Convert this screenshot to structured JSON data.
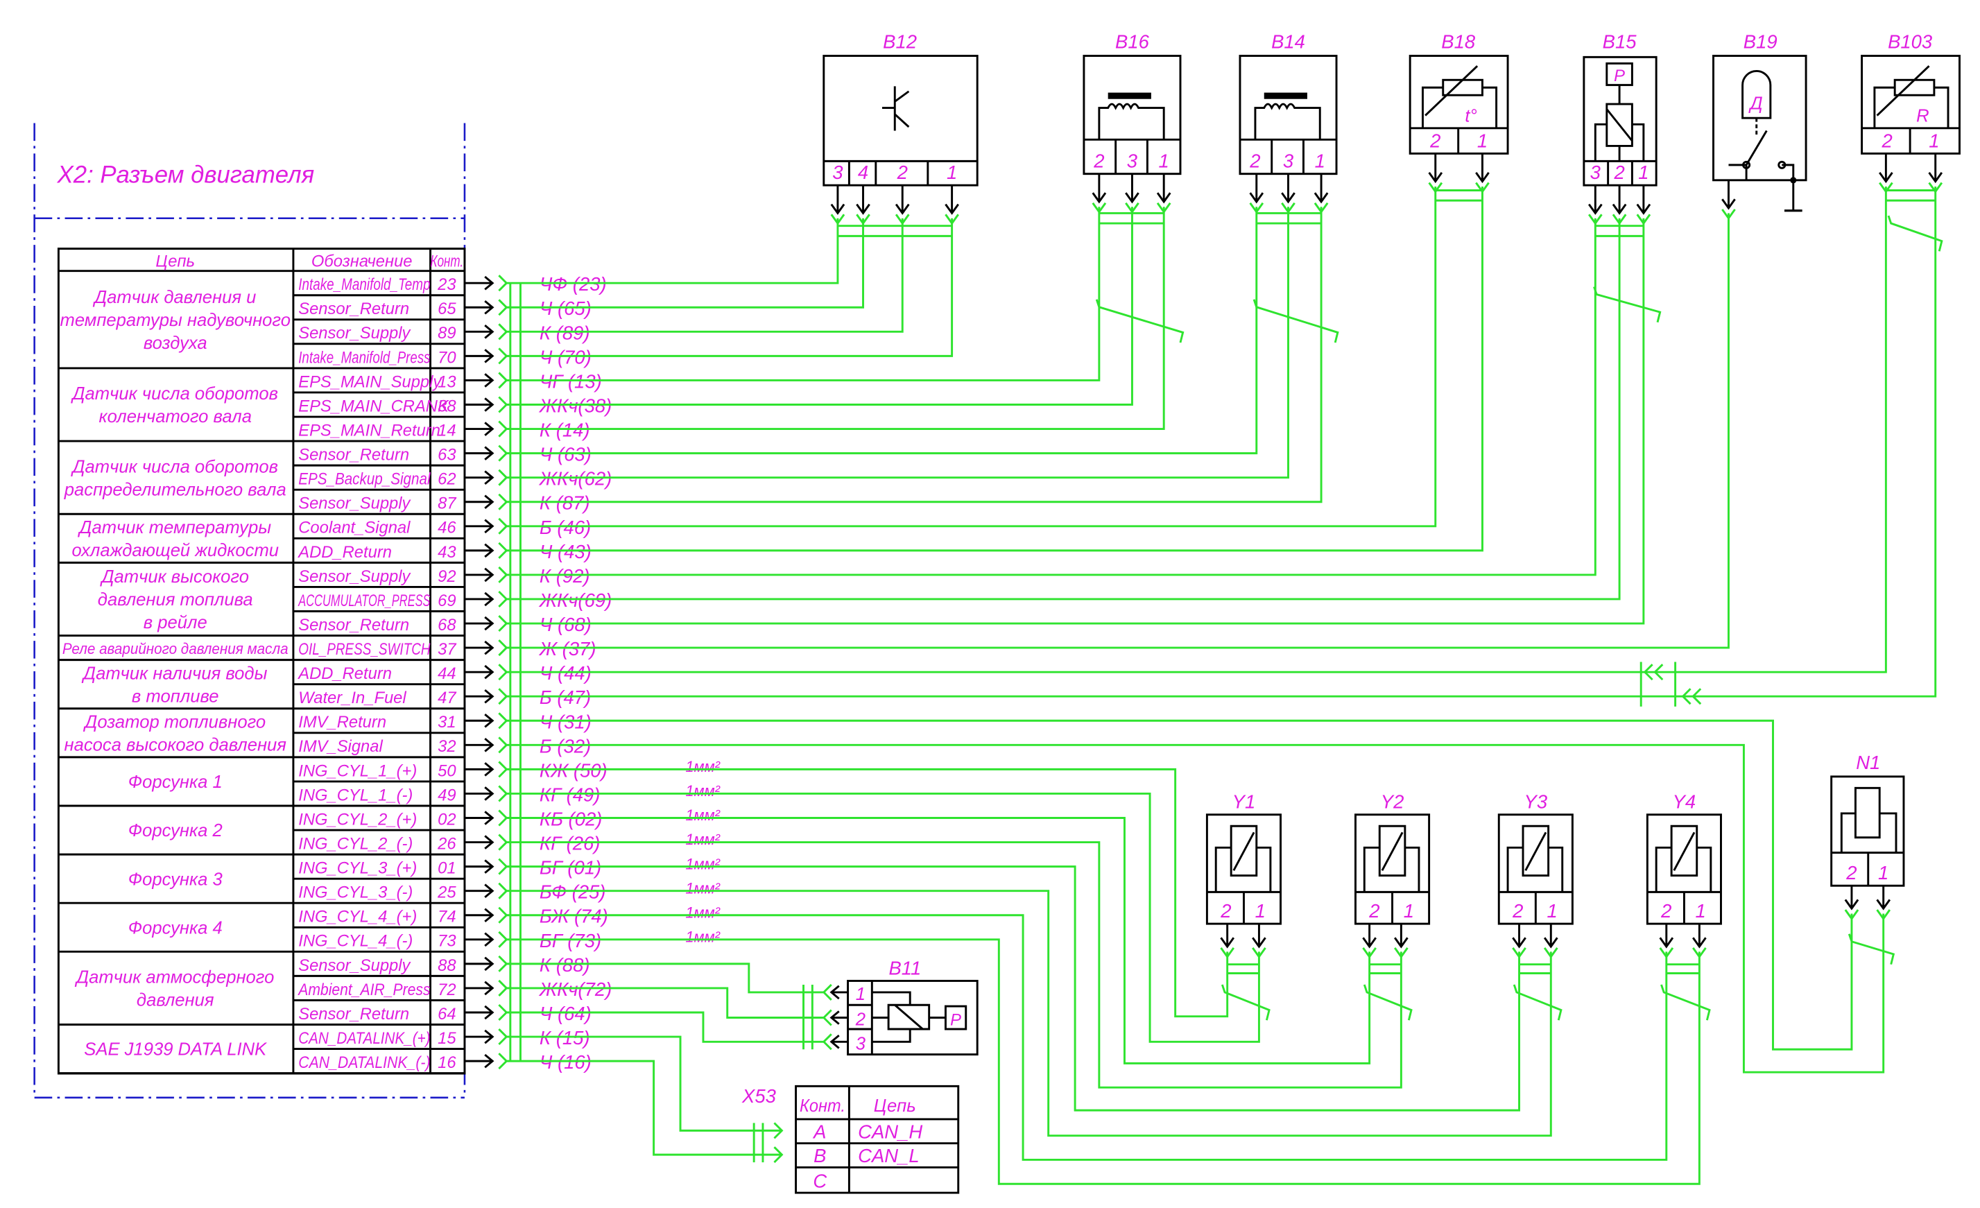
{
  "frame_title": "X2:   Разъем двигателя",
  "table": {
    "headers": [
      "Цепь",
      "Обозначение",
      "Конт."
    ],
    "groups": [
      {
        "lines": [
          "Датчик давления и",
          "температуры надувочного",
          "воздуха"
        ],
        "rows": 4
      },
      {
        "lines": [
          "Датчик числа оборотов",
          "коленчатого вала"
        ],
        "rows": 3
      },
      {
        "lines": [
          "Датчик числа оборотов",
          "распределительного вала"
        ],
        "rows": 3
      },
      {
        "lines": [
          "Датчик температуры",
          "охлаждающей жидкости"
        ],
        "rows": 2
      },
      {
        "lines": [
          "Датчик высокого",
          "давления топлива",
          "в рейле"
        ],
        "rows": 3
      },
      {
        "lines": [
          "Реле аварийного давления масла"
        ],
        "rows": 1
      },
      {
        "lines": [
          "Датчик наличия воды",
          "в топливе"
        ],
        "rows": 2
      },
      {
        "lines": [
          "Дозатор топливного",
          "насоса высокого давления"
        ],
        "rows": 2
      },
      {
        "lines": [
          "Форсунка 1"
        ],
        "rows": 2
      },
      {
        "lines": [
          "Форсунка 2"
        ],
        "rows": 2
      },
      {
        "lines": [
          "Форсунка 3"
        ],
        "rows": 2
      },
      {
        "lines": [
          "Форсунка 4"
        ],
        "rows": 2
      },
      {
        "lines": [
          "Датчик атмосферного",
          "давления"
        ],
        "rows": 3
      },
      {
        "lines": [
          "SAE J1939 DATA LINK"
        ],
        "rows": 2
      }
    ],
    "rows": [
      {
        "designation": "Intake_Manifold_Temp",
        "pin": "23",
        "wire": "ЧФ (23)"
      },
      {
        "designation": "Sensor_Return",
        "pin": "65",
        "wire": "Ч  (65)"
      },
      {
        "designation": "Sensor_Supply",
        "pin": "89",
        "wire": "К  (89)"
      },
      {
        "designation": "Intake_Manifold_Press",
        "pin": "70",
        "wire": "Ч  (70)"
      },
      {
        "designation": "EPS_MAIN_Supply",
        "pin": "13",
        "wire": "ЧГ (13)"
      },
      {
        "designation": "EPS_MAIN_CRANK",
        "pin": "38",
        "wire": "ЖКч(38)"
      },
      {
        "designation": "EPS_MAIN_Return",
        "pin": "14",
        "wire": "К  (14)"
      },
      {
        "designation": "Sensor_Return",
        "pin": "63",
        "wire": "Ч  (63)"
      },
      {
        "designation": "EPS_Backup_Signal",
        "pin": "62",
        "wire": "ЖКч(62)"
      },
      {
        "designation": "Sensor_Supply",
        "pin": "87",
        "wire": "К  (87)"
      },
      {
        "designation": "Coolant_Signal",
        "pin": "46",
        "wire": "Б  (46)"
      },
      {
        "designation": "ADD_Return",
        "pin": "43",
        "wire": "Ч  (43)"
      },
      {
        "designation": "Sensor_Supply",
        "pin": "92",
        "wire": "К  (92)"
      },
      {
        "designation": "ACCUMULATOR_PRESS",
        "pin": "69",
        "wire": "ЖКч(69)"
      },
      {
        "designation": "Sensor_Return",
        "pin": "68",
        "wire": "Ч  (68)"
      },
      {
        "designation": "OIL_PRESS_SWITCH",
        "pin": "37",
        "wire": "Ж  (37)"
      },
      {
        "designation": "ADD_Return",
        "pin": "44",
        "wire": "Ч  (44)"
      },
      {
        "designation": "Water_In_Fuel",
        "pin": "47",
        "wire": "Б  (47)"
      },
      {
        "designation": "IMV_Return",
        "pin": "31",
        "wire": "Ч  (31)"
      },
      {
        "designation": "IMV_Signal",
        "pin": "32",
        "wire": "Б  (32)"
      },
      {
        "designation": "ING_CYL_1_(+)",
        "pin": "50",
        "wire": "КЖ (50)",
        "section": "1мм²"
      },
      {
        "designation": "ING_CYL_1_(-)",
        "pin": "49",
        "wire": "КГ (49)",
        "section": "1мм²"
      },
      {
        "designation": "ING_CYL_2_(+)",
        "pin": "02",
        "wire": "КБ (02)",
        "section": "1мм²"
      },
      {
        "designation": "ING_CYL_2_(-)",
        "pin": "26",
        "wire": "КГ (26)",
        "section": "1мм²"
      },
      {
        "designation": "ING_CYL_3_(+)",
        "pin": "01",
        "wire": "БГ (01)",
        "section": "1мм²"
      },
      {
        "designation": "ING_CYL_3_(-)",
        "pin": "25",
        "wire": "БФ (25)",
        "section": "1мм²"
      },
      {
        "designation": "ING_CYL_4_(+)",
        "pin": "74",
        "wire": "БЖ (74)",
        "section": "1мм²"
      },
      {
        "designation": "ING_CYL_4_(-)",
        "pin": "73",
        "wire": "БГ (73)",
        "section": "1мм²"
      },
      {
        "designation": "Sensor_Supply",
        "pin": "88",
        "wire": "К  (88)"
      },
      {
        "designation": "Ambient_AIR_Press",
        "pin": "72",
        "wire": "ЖКч(72)"
      },
      {
        "designation": "Sensor_Return",
        "pin": "64",
        "wire": "Ч  (64)"
      },
      {
        "designation": "CAN_DATALINK_(+)",
        "pin": "15",
        "wire": "К  (15)"
      },
      {
        "designation": "CAN_DATALINK_(-)",
        "pin": "16",
        "wire": "Ч  (16)"
      }
    ]
  },
  "components": {
    "B12": {
      "label": "B12",
      "pins": [
        "3",
        "4",
        "2",
        "1"
      ],
      "symbol": "transistor"
    },
    "B16": {
      "label": "B16",
      "pins": [
        "2",
        "3",
        "1"
      ],
      "symbol": "inductive-sensor"
    },
    "B14": {
      "label": "B14",
      "pins": [
        "2",
        "3",
        "1"
      ],
      "symbol": "inductive-sensor"
    },
    "B18": {
      "label": "B18",
      "pins": [
        "2",
        "1"
      ],
      "symbol": "thermistor",
      "mark": "t°"
    },
    "B15": {
      "label": "B15",
      "pins": [
        "3",
        "2",
        "1"
      ],
      "symbol": "pressure-sensor",
      "mark": "P"
    },
    "B19": {
      "label": "B19",
      "symbol": "pressure-switch",
      "mark": "Д"
    },
    "B103": {
      "label": "B103",
      "pins": [
        "2",
        "1"
      ],
      "symbol": "variable-resistor",
      "mark": "R"
    },
    "B11": {
      "label": "B11",
      "pins": [
        "1",
        "2",
        "3"
      ],
      "symbol": "pressure-sensor",
      "mark": "P"
    },
    "Y1": {
      "label": "Y1",
      "pins": [
        "2",
        "1"
      ],
      "symbol": "solenoid"
    },
    "Y2": {
      "label": "Y2",
      "pins": [
        "2",
        "1"
      ],
      "symbol": "solenoid"
    },
    "Y3": {
      "label": "Y3",
      "pins": [
        "2",
        "1"
      ],
      "symbol": "solenoid"
    },
    "Y4": {
      "label": "Y4",
      "pins": [
        "2",
        "1"
      ],
      "symbol": "solenoid"
    },
    "N1": {
      "label": "N1",
      "pins": [
        "2",
        "1"
      ],
      "symbol": "metering-valve"
    }
  },
  "x53": {
    "label": "X53",
    "headers": [
      "Конт.",
      "Цепь"
    ],
    "rows": [
      {
        "pin": "A",
        "circuit": "CAN_H"
      },
      {
        "pin": "B",
        "circuit": "CAN_L"
      },
      {
        "pin": "C",
        "circuit": ""
      }
    ]
  },
  "colors": {
    "wire": "#2fe32f",
    "text": "#e01ee0",
    "frame": "#1a1ac8",
    "line": "#000000",
    "x53_separator": "#c00000"
  }
}
